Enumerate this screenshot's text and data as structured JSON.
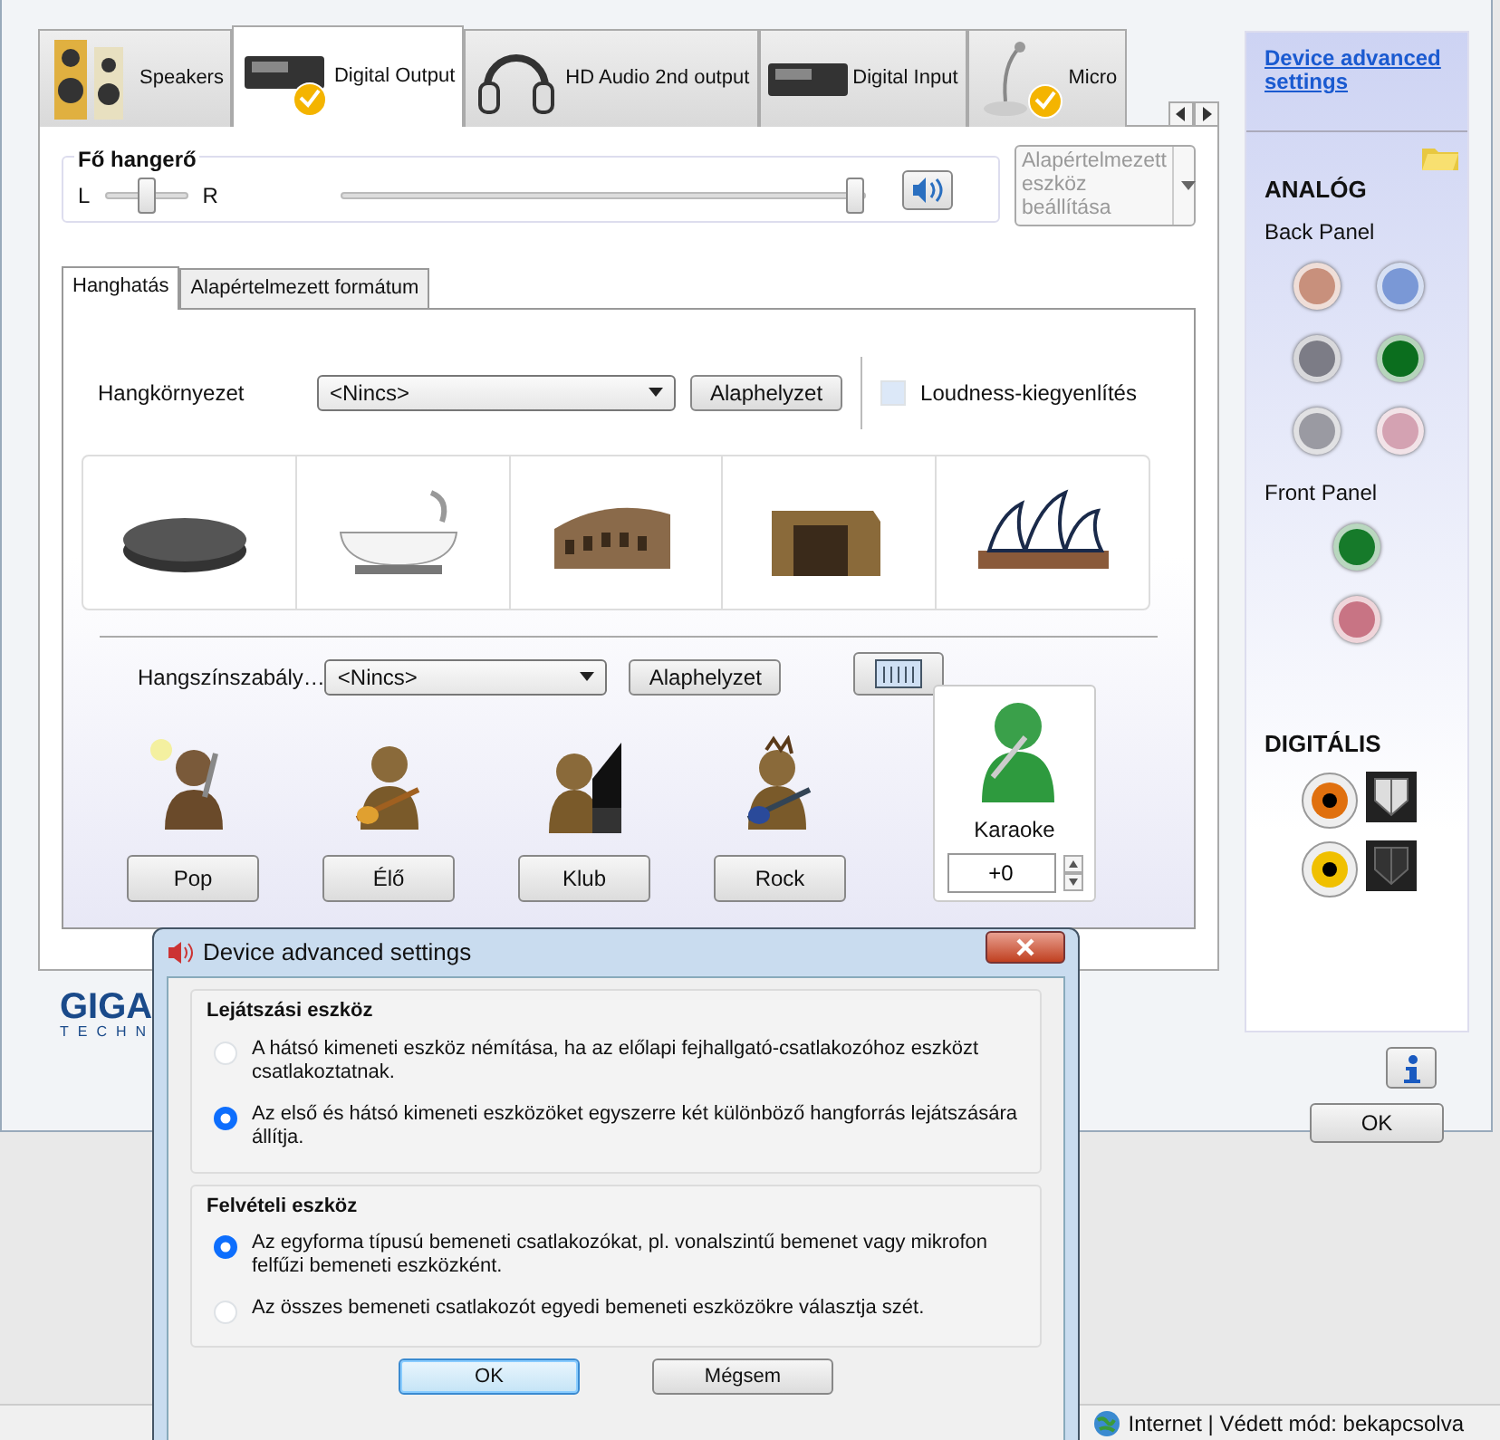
{
  "device_tabs": [
    {
      "label": "Speakers",
      "selected": false
    },
    {
      "label": "Digital Output",
      "selected": true
    },
    {
      "label": "HD Audio 2nd output",
      "selected": false
    },
    {
      "label": "Digital Input",
      "selected": false
    },
    {
      "label": "Micro",
      "selected": false
    }
  ],
  "master_volume": {
    "title": "Fő hangerő",
    "balance": {
      "left": "L",
      "right": "R",
      "level": 0.5
    },
    "level": 0.98,
    "muted": false
  },
  "default_device": {
    "label": "Alapértelmezett eszköz beállítása",
    "disabled": true
  },
  "effect_tabs": [
    {
      "label": "Hanghatás",
      "selected": true
    },
    {
      "label": "Alapértelmezett formátum",
      "selected": false
    }
  ],
  "environment": {
    "label": "Hangkörnyezet",
    "value": "<Nincs>",
    "reset": "Alaphelyzet",
    "loudness": {
      "label": "Loudness-kiegyenlítés",
      "checked": false
    }
  },
  "equalizer": {
    "label": "Hangszínszabály…",
    "value": "<Nincs>",
    "reset": "Alaphelyzet",
    "presets": [
      {
        "label": "Pop"
      },
      {
        "label": "Élő"
      },
      {
        "label": "Klub"
      },
      {
        "label": "Rock"
      }
    ],
    "karaoke": {
      "label": "Karaoke",
      "value": "+0"
    }
  },
  "sidebar": {
    "link": "Device advanced settings",
    "analog_title": "ANALÓG",
    "back_panel_title": "Back Panel",
    "back_jacks": [
      {
        "color": "#c8907c"
      },
      {
        "color": "#7a98d6"
      },
      {
        "color": "#7c7c86"
      },
      {
        "color": "#0b6e1e"
      },
      {
        "color": "#9a9aa2"
      },
      {
        "color": "#d4a2b2"
      }
    ],
    "front_panel_title": "Front Panel",
    "front_jacks": [
      {
        "color": "#167a2a"
      },
      {
        "color": "#c87484"
      }
    ],
    "digital_title": "DIGITÁLIS",
    "digital_ports": [
      {
        "color": "#e0700e",
        "active": true
      },
      {
        "color": "#f0c000",
        "active": false
      }
    ]
  },
  "brand": {
    "name": "GIGA",
    "subtitle": "TECHN"
  },
  "ok_button": "OK",
  "dialog": {
    "title": "Device advanced settings",
    "groups": [
      {
        "title": "Lejátszási eszköz",
        "options": [
          {
            "label": "A hátsó kimeneti eszköz némítása, ha az előlapi fejhallgató-csatlakozóhoz eszközt csatlakoztatnak.",
            "selected": false
          },
          {
            "label": "Az első és hátsó kimeneti eszközöket egyszerre két különböző hangforrás lejátszására állítja.",
            "selected": true
          }
        ]
      },
      {
        "title": "Felvételi eszköz",
        "options": [
          {
            "label": "Az egyforma típusú bemeneti csatlakozókat, pl. vonalszintű bemenet vagy mikrofon felfűzi bemeneti eszközként.",
            "selected": true
          },
          {
            "label": "Az összes bemeneti csatlakozót egyedi bemeneti eszközökre választja szét.",
            "selected": false
          }
        ]
      }
    ],
    "buttons": [
      {
        "label": "OK",
        "default": true
      },
      {
        "label": "Mégsem",
        "default": false
      }
    ]
  },
  "status_bar": {
    "zone": "Internet | Védett mód: bekapcsolva"
  }
}
